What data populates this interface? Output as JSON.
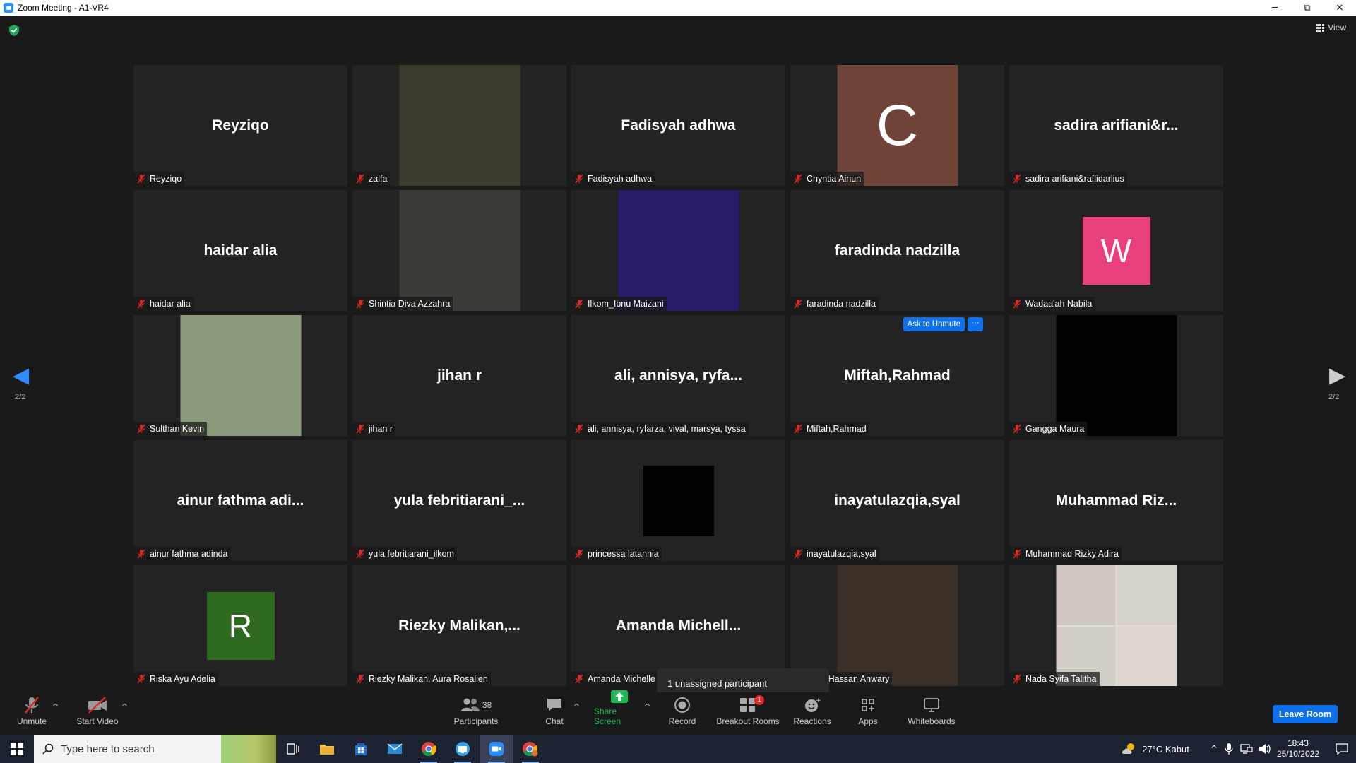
{
  "window": {
    "title": "Zoom Meeting - A1-VR4",
    "minimize": "─",
    "restore": "⧉",
    "close": "✕"
  },
  "top": {
    "view_label": "View"
  },
  "pagination": {
    "left": "2/2",
    "right": "2/2"
  },
  "tiles": [
    {
      "big": "Reyziqo",
      "name": "Reyziqo",
      "kind": "name"
    },
    {
      "big": "",
      "name": "zalfa",
      "kind": "photo",
      "color": "#3b3a2c"
    },
    {
      "big": "Fadisyah adhwa",
      "name": "Fadisyah adhwa",
      "kind": "name"
    },
    {
      "big": "C",
      "name": "Chyntia Ainun",
      "kind": "letter-full",
      "color": "#6e4438"
    },
    {
      "big": "sadira arifiani&r...",
      "name": "sadira arifiani&raflidarlius",
      "kind": "name"
    },
    {
      "big": "haidar alia",
      "name": "haidar alia",
      "kind": "name"
    },
    {
      "big": "",
      "name": "Shintia Diva Azzahra",
      "kind": "photo",
      "color": "#3a3a36"
    },
    {
      "big": "",
      "name": "Ilkom_Ibnu Maizani",
      "kind": "photo",
      "color": "#2a1a6a"
    },
    {
      "big": "faradinda nadzilla",
      "name": "faradinda nadzilla",
      "kind": "name"
    },
    {
      "big": "W",
      "name": "Wadaa'ah Nabila",
      "kind": "letter",
      "color": "#e8407c"
    },
    {
      "big": "",
      "name": "Sulthan Kevin",
      "kind": "photo",
      "color": "#8a9a7a"
    },
    {
      "big": "jihan r",
      "name": "jihan r",
      "kind": "name"
    },
    {
      "big": "ali, annisya, ryfa...",
      "name": "ali, annisya, ryfarza, vival, marsya, tyssa",
      "kind": "name"
    },
    {
      "big": "Miftah,Rahmad",
      "name": "Miftah,Rahmad",
      "kind": "name",
      "ask": true
    },
    {
      "big": "",
      "name": "Gangga Maura",
      "kind": "black"
    },
    {
      "big": "ainur fathma adi...",
      "name": "ainur fathma adinda",
      "kind": "name"
    },
    {
      "big": "yula febritiarani_...",
      "name": "yula febritiarani_ilkom",
      "kind": "name"
    },
    {
      "big": "",
      "name": "princessa latannia",
      "kind": "black-small"
    },
    {
      "big": "inayatulazqia,syal",
      "name": "inayatulazqia,syal",
      "kind": "name"
    },
    {
      "big": "Muhammad Riz...",
      "name": "Muhammad Rizky Adira",
      "kind": "name"
    },
    {
      "big": "R",
      "name": "Riska Ayu Adelia",
      "kind": "letter",
      "color": "#2e6b20"
    },
    {
      "big": "Riezky Malikan,...",
      "name": "Riezky Malikan, Aura Rosalien",
      "kind": "name"
    },
    {
      "big": "Amanda Michell...",
      "name": "Amanda Michelle",
      "kind": "name"
    },
    {
      "big": "",
      "name": "ulam Hassan Anwary",
      "kind": "photo",
      "color": "#3a3028"
    },
    {
      "big": "",
      "name": "Nada Syifa Talitha",
      "kind": "photo-quad",
      "color": "#e0dcd8"
    }
  ],
  "ask_to_unmute": {
    "label": "Ask to Unmute",
    "more": "···"
  },
  "toast": "1 unassigned participant",
  "toolbar": {
    "unmute": "Unmute",
    "start_video": "Start Video",
    "participants": "Participants",
    "participants_count": "38",
    "chat": "Chat",
    "share_screen": "Share Screen",
    "record": "Record",
    "breakout_rooms": "Breakout Rooms",
    "breakout_badge": "1",
    "reactions": "Reactions",
    "apps": "Apps",
    "whiteboards": "Whiteboards",
    "leave": "Leave Room"
  },
  "taskbar": {
    "search_placeholder": "Type here to search",
    "weather": "27°C  Kabut",
    "time": "18:43",
    "date": "25/10/2022"
  },
  "colors": {
    "accent": "#0e71eb",
    "share_green": "#1db954",
    "badge_red": "#e02828"
  }
}
